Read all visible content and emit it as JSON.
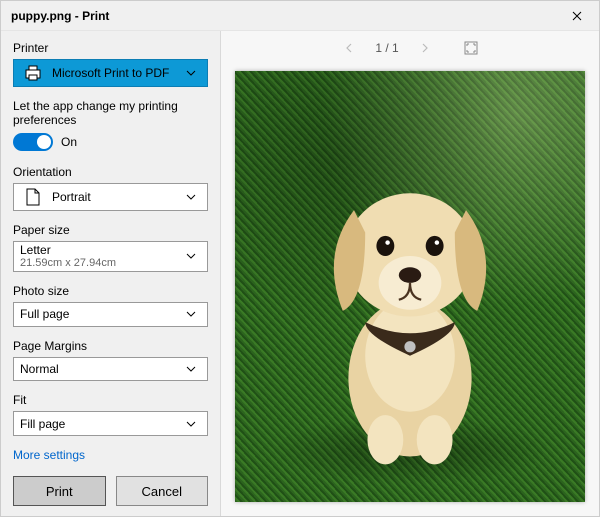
{
  "title": "puppy.png - Print",
  "panel": {
    "printer_label": "Printer",
    "printer_value": "Microsoft Print to PDF",
    "pref_text": "Let the app change my printing preferences",
    "toggle_state": "On",
    "orientation_label": "Orientation",
    "orientation_value": "Portrait",
    "paper_label": "Paper size",
    "paper_value": "Letter",
    "paper_sub": "21.59cm x 27.94cm",
    "photo_label": "Photo size",
    "photo_value": "Full page",
    "margins_label": "Page Margins",
    "margins_value": "Normal",
    "fit_label": "Fit",
    "fit_value": "Fill page",
    "more": "More settings",
    "print": "Print",
    "cancel": "Cancel"
  },
  "preview": {
    "page": "1 / 1",
    "image_description": "Golden retriever puppy sitting on green grass looking up"
  }
}
